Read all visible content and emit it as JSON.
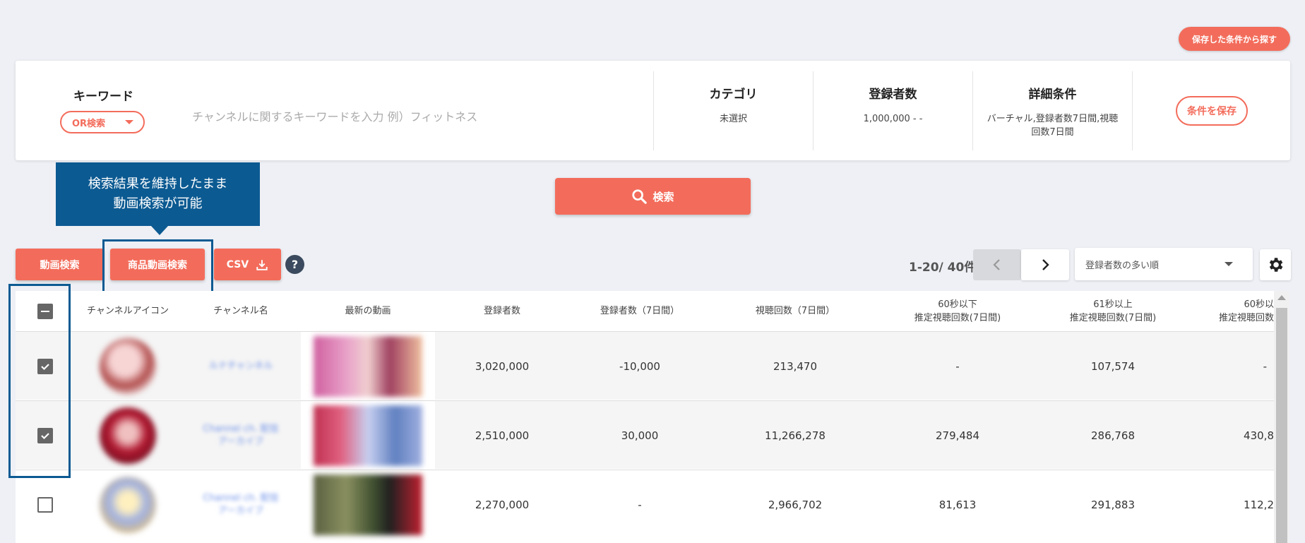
{
  "header": {
    "saved_search_label": "保存した条件から探す"
  },
  "search_panel": {
    "keyword_title": "キーワード",
    "match_mode": "OR検索",
    "keyword_placeholder": "チャンネルに関するキーワードを入力 例）フィットネス",
    "category": {
      "title": "カテゴリ",
      "value": "未選択"
    },
    "subscribers": {
      "title": "登録者数",
      "value": "1,000,000 - -"
    },
    "details": {
      "title": "詳細条件",
      "value": "バーチャル,登録者数7日間,視聴回数7日間"
    },
    "save_condition_label": "条件を保存"
  },
  "tooltip": {
    "line1": "検索結果を維持したまま",
    "line2": "動画検索が可能"
  },
  "search_button_label": "検索",
  "toolbar": {
    "video_search_label": "動画検索",
    "product_video_search_label": "商品動画検索",
    "csv_label": "CSV",
    "help_label": "?",
    "result_count": "1-20/ 40件",
    "sort_selected": "登録者数の多い順"
  },
  "table": {
    "headers": {
      "icon": "チャンネルアイコン",
      "name": "チャンネル名",
      "latest_video": "最新の動画",
      "subscribers": "登録者数",
      "subscribers_7d": "登録者数（7日間）",
      "views_7d": "視聴回数（7日間）",
      "short_views_line1": "60秒以下",
      "short_views_line2": "推定視聴回数(7日間)",
      "long_views_line1": "61秒以上",
      "long_views_line2": "推定視聴回数(7日間)",
      "extra_line1": "60秒以",
      "extra_line2": "推定視聴回数"
    },
    "rows": [
      {
        "checked": true,
        "name": "ルナチャンネル",
        "subscribers": "3,020,000",
        "subscribers_7d": "-10,000",
        "views_7d": "213,470",
        "short_views": "-",
        "long_views": "107,574",
        "extra": "-"
      },
      {
        "checked": true,
        "name": "Channel ch. 配信アーカイブ",
        "subscribers": "2,510,000",
        "subscribers_7d": "30,000",
        "views_7d": "11,266,278",
        "short_views": "279,484",
        "long_views": "286,768",
        "extra": "430,8"
      },
      {
        "checked": false,
        "name": "Channel ch. 配信アーカイブ",
        "subscribers": "2,270,000",
        "subscribers_7d": "-",
        "views_7d": "2,966,702",
        "short_views": "81,613",
        "long_views": "291,883",
        "extra": "112,2"
      }
    ]
  },
  "colors": {
    "accent": "#f36c5b",
    "highlight": "#0c5a92",
    "background": "#eef0f5"
  }
}
